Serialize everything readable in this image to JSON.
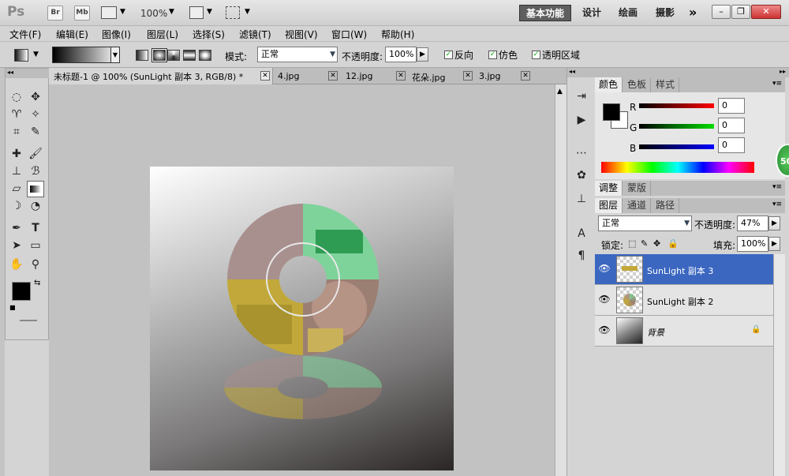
{
  "app": {
    "logo": "Ps",
    "bridge": "Br",
    "minibridge": "Mb",
    "zoom": "100%",
    "workspaces": [
      "基本功能",
      "设计",
      "绘画",
      "摄影"
    ],
    "more": "»"
  },
  "menu": [
    "文件(F)",
    "编辑(E)",
    "图像(I)",
    "图层(L)",
    "选择(S)",
    "滤镜(T)",
    "视图(V)",
    "窗口(W)",
    "帮助(H)"
  ],
  "options": {
    "mode_label": "模式:",
    "mode_value": "正常",
    "opacity_label": "不透明度:",
    "opacity_value": "100%",
    "reverse": "反向",
    "dither": "仿色",
    "transparency": "透明区域"
  },
  "doc_tabs": [
    "未标题-1 @ 100% (SunLight 副本 3, RGB/8) *",
    "4.jpg",
    "12.jpg",
    "花朵.jpg",
    "3.jpg"
  ],
  "color_panel": {
    "tabs": [
      "颜色",
      "色板",
      "样式"
    ],
    "r_label": "R",
    "g_label": "G",
    "b_label": "B",
    "r": "0",
    "g": "0",
    "b": "0"
  },
  "adjust_panel": {
    "tabs": [
      "调整",
      "蒙版"
    ]
  },
  "layers_panel": {
    "tabs": [
      "图层",
      "通道",
      "路径"
    ],
    "blend": "正常",
    "opacity_label": "不透明度:",
    "opacity": "47%",
    "lock_label": "锁定:",
    "fill_label": "填充:",
    "fill": "100%",
    "layers": [
      {
        "name": "SunLight 副本 3",
        "selected": true
      },
      {
        "name": "SunLight 副本 2",
        "selected": false
      },
      {
        "name": "背景",
        "selected": false
      }
    ]
  },
  "badge": "50",
  "colors": {
    "selection": "#3b67c0",
    "accent_green": "#2ea043"
  }
}
